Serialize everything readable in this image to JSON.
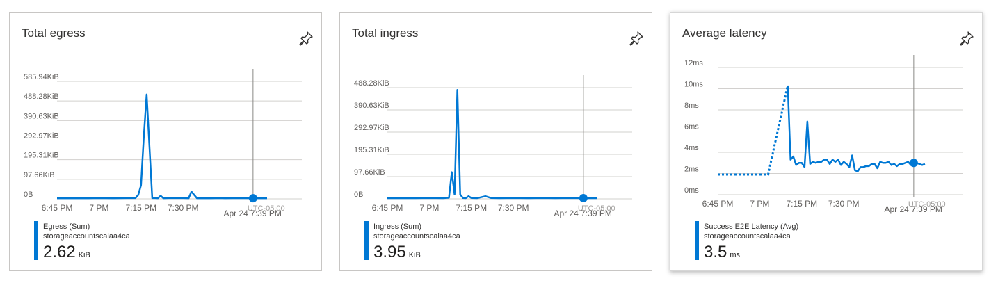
{
  "colors": {
    "series": "#0078d4",
    "grid": "#d2d0ce",
    "cursor": "#8a8886"
  },
  "cards": [
    {
      "title": "Total egress",
      "pin_icon": "pin-icon",
      "legend": {
        "metric": "Egress (Sum)",
        "resource": "storageaccountscalaa4ca",
        "value": "2.62",
        "unit": "KiB"
      },
      "cursor_date": "Apr 24 7:39 PM",
      "tz_label": "UTC-05:00",
      "chart_data": {
        "type": "line",
        "title": "Total egress",
        "y_ticks": [
          "0B",
          "97.66KiB",
          "195.31KiB",
          "292.97KiB",
          "390.63KiB",
          "488.28KiB",
          "585.94KiB"
        ],
        "x_ticks": [
          "6:45 PM",
          "7 PM",
          "7:15 PM",
          "7:30 PM"
        ],
        "ylim": [
          0,
          600
        ],
        "yunit": "KiB",
        "x_minutes": [
          0,
          5,
          10,
          15,
          20,
          25,
          28,
          29,
          30,
          31,
          32,
          34,
          35,
          36,
          37,
          38,
          40,
          45,
          47,
          48,
          50,
          55,
          58,
          60,
          65,
          70,
          72,
          75
        ],
        "series": [
          {
            "name": "Egress (Sum)",
            "values": [
              3,
              3,
              3,
              4,
              3,
              4,
              4,
              20,
              70,
              320,
              533,
              4,
              4,
              3,
              16,
              3,
              4,
              4,
              3,
              37,
              3,
              3,
              4,
              3,
              4,
              3,
              3,
              3
            ]
          }
        ],
        "cursor_minute": 70
      }
    },
    {
      "title": "Total ingress",
      "pin_icon": "pin-icon",
      "legend": {
        "metric": "Ingress (Sum)",
        "resource": "storageaccountscalaa4ca",
        "value": "3.95",
        "unit": "KiB"
      },
      "cursor_date": "Apr 24 7:39 PM",
      "tz_label": "UTC-05:00",
      "chart_data": {
        "type": "line",
        "title": "Total ingress",
        "y_ticks": [
          "0B",
          "97.66KiB",
          "195.31KiB",
          "292.97KiB",
          "390.63KiB",
          "488.28KiB"
        ],
        "x_ticks": [
          "6:45 PM",
          "7 PM",
          "7:15 PM",
          "7:30 PM"
        ],
        "ylim": [
          0,
          500
        ],
        "yunit": "KiB",
        "x_minutes": [
          0,
          5,
          10,
          15,
          20,
          22,
          23,
          24,
          25,
          26,
          27,
          28,
          29,
          30,
          32,
          35,
          37,
          40,
          45,
          50,
          55,
          60,
          65,
          70,
          72,
          75
        ],
        "series": [
          {
            "name": "Ingress (Sum)",
            "values": [
              3,
              3,
              3,
              4,
              3,
              5,
              120,
              20,
              490,
              20,
              4,
              3,
              12,
              4,
              3,
              12,
              4,
              3,
              4,
              3,
              4,
              3,
              4,
              3,
              3,
              3
            ]
          }
        ],
        "cursor_minute": 70
      }
    },
    {
      "title": "Average latency",
      "pin_icon": "pin-icon",
      "legend": {
        "metric": "Success E2E Latency (Avg)",
        "resource": "storageaccountscalaa4ca",
        "value": "3.5",
        "unit": "ms"
      },
      "cursor_date": "Apr 24 7:39 PM",
      "tz_label": "UTC-05:00",
      "chart_data": {
        "type": "line",
        "title": "Average latency",
        "y_ticks": [
          "0ms",
          "2ms",
          "4ms",
          "6ms",
          "8ms",
          "10ms",
          "12ms"
        ],
        "x_ticks": [
          "6:45 PM",
          "7 PM",
          "7:15 PM",
          "7:30 PM"
        ],
        "ylim": [
          0,
          12
        ],
        "yunit": "ms",
        "dotted_x_minutes": [
          0,
          17,
          18,
          25
        ],
        "dotted_values": [
          1.9,
          1.9,
          1.9,
          10.3
        ],
        "x_minutes": [
          25,
          26,
          27,
          28,
          29,
          30,
          31,
          32,
          33,
          34,
          35,
          36,
          37,
          38,
          39,
          40,
          41,
          42,
          43,
          44,
          45,
          46,
          47,
          48,
          49,
          50,
          51,
          52,
          53,
          54,
          55,
          56,
          57,
          58,
          59,
          60,
          61,
          62,
          63,
          64,
          65,
          66,
          67,
          68,
          69,
          70,
          71,
          72,
          73,
          74
        ],
        "series": [
          {
            "name": "Success E2E Latency (Avg)",
            "values": [
              10.3,
              3.3,
              3.6,
              2.8,
              3,
              3,
              2.6,
              6.9,
              2.9,
              3.1,
              3,
              3.1,
              3.1,
              3.3,
              3.3,
              2.9,
              3.3,
              3.1,
              3.3,
              2.8,
              3.1,
              2.9,
              2.6,
              3.7,
              2.3,
              2.2,
              2.6,
              2.6,
              2.7,
              2.7,
              2.9,
              2.9,
              2.5,
              3.1,
              3,
              3,
              3.1,
              2.8,
              2.9,
              2.7,
              2.9,
              2.9,
              3,
              3.1,
              2.8,
              3,
              3,
              2.9,
              2.8,
              2.9
            ]
          }
        ],
        "cursor_minute": 70
      }
    }
  ]
}
